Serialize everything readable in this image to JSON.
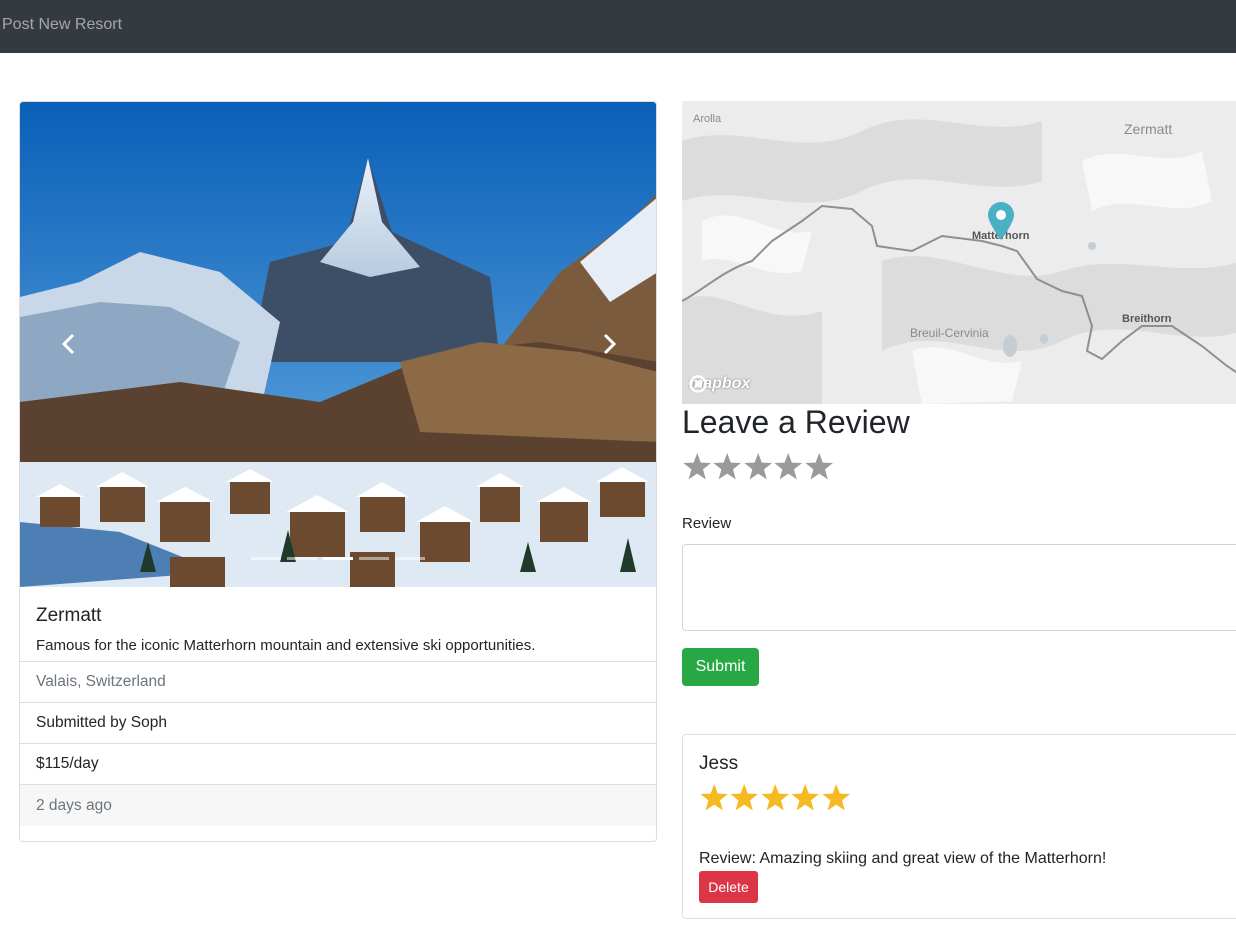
{
  "navbar": {
    "link_label": "Post New Resort"
  },
  "resort": {
    "title": "Zermatt",
    "description": "Famous for the iconic Matterhorn mountain and extensive ski opportunities.",
    "location": "Valais, Switzerland",
    "submitted_by": "Submitted by Soph",
    "price": "$115/day",
    "posted": "2 days ago",
    "carousel": {
      "slide_count": 5,
      "active_index": 2
    }
  },
  "map": {
    "labels": {
      "arolla": "Arolla",
      "zermatt": "Zermatt",
      "matterhorn": "Matterhorn",
      "breuil": "Breuil-Cervinia",
      "breithorn": "Breithorn"
    },
    "attribution": "mapbox",
    "marker_color": "#4ab0c5"
  },
  "review_form": {
    "heading": "Leave a Review",
    "rating_max": 5,
    "rating_value": 0,
    "review_label": "Review",
    "review_value": "",
    "submit_label": "Submit"
  },
  "reviews": [
    {
      "author": "Jess",
      "rating": 5,
      "text": "Review: Amazing skiing and great view of the Matterhorn!",
      "delete_label": "Delete"
    }
  ],
  "colors": {
    "navbar": "#343a40",
    "submit": "#28a745",
    "delete": "#dc3545",
    "star_filled": "#f5b921",
    "star_empty": "#9a9a9a"
  }
}
